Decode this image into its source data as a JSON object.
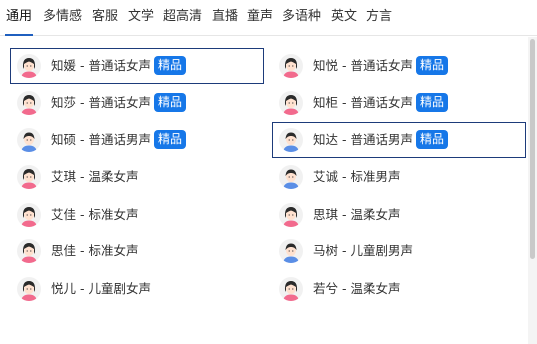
{
  "tabs": [
    {
      "label": "通用",
      "active": true
    },
    {
      "label": "多情感"
    },
    {
      "label": "客服"
    },
    {
      "label": "文学"
    },
    {
      "label": "超高清"
    },
    {
      "label": "直播"
    },
    {
      "label": "童声"
    },
    {
      "label": "多语种"
    },
    {
      "label": "英文"
    },
    {
      "label": "方言"
    }
  ],
  "voices": [
    {
      "label": "知媛 - 普通话女声",
      "badge": "精品",
      "gender": "female",
      "selected": true
    },
    {
      "label": "知悦 - 普通话女声",
      "badge": "精品",
      "gender": "female"
    },
    {
      "label": "知莎 - 普通话女声",
      "badge": "精品",
      "gender": "female"
    },
    {
      "label": "知柜 - 普通话女声",
      "badge": "精品",
      "gender": "female"
    },
    {
      "label": "知硕 - 普通话男声",
      "badge": "精品",
      "gender": "male"
    },
    {
      "label": "知达 - 普通话男声",
      "badge": "精品",
      "gender": "male",
      "selected": true
    },
    {
      "label": "艾琪 - 温柔女声",
      "gender": "female"
    },
    {
      "label": "艾诚 - 标准男声",
      "gender": "male"
    },
    {
      "label": "艾佳 - 标准女声",
      "gender": "female"
    },
    {
      "label": "思琪 - 温柔女声",
      "gender": "female"
    },
    {
      "label": "思佳 - 标准女声",
      "gender": "female"
    },
    {
      "label": "马树 - 儿童剧男声",
      "gender": "male"
    },
    {
      "label": "悦儿 - 儿童剧女声",
      "gender": "female"
    },
    {
      "label": "若兮 - 温柔女声",
      "gender": "female"
    }
  ],
  "colors": {
    "accent": "#1677e8",
    "selected_border": "#1d3b7a",
    "female_top": "#f26a8d",
    "male_top": "#5a8ee6",
    "hair": "#2b2b2b",
    "skin": "#ffe1cf"
  }
}
